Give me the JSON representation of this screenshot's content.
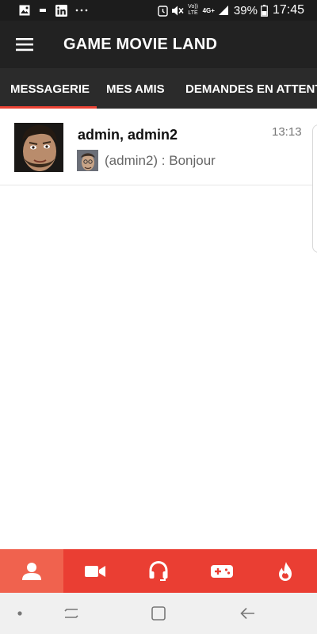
{
  "status_bar": {
    "battery_percent": "39%",
    "time": "17:45",
    "network_label": "4G+",
    "volte_label": "Vo)) LTE",
    "notification_icons": [
      "image-icon",
      "minus-icon",
      "linkedin-icon",
      "more-dots-icon"
    ],
    "system_icons": [
      "alarm-icon",
      "mute-icon",
      "signal-icon",
      "battery-icon"
    ]
  },
  "app_bar": {
    "title": "GAME MOVIE LAND",
    "menu_icon": "hamburger-menu-icon"
  },
  "tabs": [
    {
      "label": "MESSAGERIE",
      "active": true
    },
    {
      "label": "MES AMIS",
      "active": false
    },
    {
      "label": "DEMANDES EN ATTENTE",
      "active": false
    }
  ],
  "conversations": [
    {
      "title": "admin, admin2",
      "time": "13:13",
      "last_message": "(admin2) : Bonjour"
    }
  ],
  "bottom_nav": [
    {
      "icon": "person-icon",
      "active": true
    },
    {
      "icon": "video-camera-icon",
      "active": false
    },
    {
      "icon": "headset-icon",
      "active": false
    },
    {
      "icon": "gamepad-icon",
      "active": false
    },
    {
      "icon": "flame-icon",
      "active": false
    }
  ],
  "system_nav": [
    "dot-icon",
    "recents-icon",
    "home-icon",
    "back-icon"
  ],
  "colors": {
    "accent": "#ea3e33",
    "accent_light": "#f0624e",
    "app_bar": "#222222",
    "tab_bar": "#2b2b2b"
  }
}
